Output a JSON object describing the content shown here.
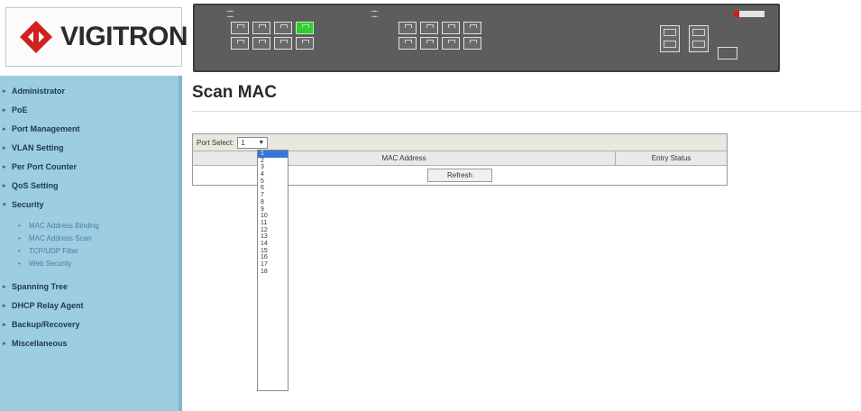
{
  "logo": {
    "text": "VIGITRON"
  },
  "sidebar": {
    "items": [
      {
        "label": "Administrator"
      },
      {
        "label": "PoE"
      },
      {
        "label": "Port Management"
      },
      {
        "label": "VLAN Setting"
      },
      {
        "label": "Per Port Counter"
      },
      {
        "label": "QoS Setting"
      },
      {
        "label": "Security"
      },
      {
        "label": "Spanning Tree"
      },
      {
        "label": "DHCP Relay Agent"
      },
      {
        "label": "Backup/Recovery"
      },
      {
        "label": "Miscellaneous"
      }
    ],
    "security_sub": [
      {
        "label": "MAC Address Binding"
      },
      {
        "label": "MAC Address Scan"
      },
      {
        "label": "TCP/UDP Filter"
      },
      {
        "label": "Web Security"
      }
    ]
  },
  "main": {
    "title": "Scan MAC",
    "port_select_label": "Port Select:",
    "port_select_value": "1",
    "col_mac": "MAC Address",
    "col_status": "Entry Status",
    "refresh_label": "Refresh"
  },
  "dropdown": {
    "options": [
      "1",
      "2",
      "3",
      "4",
      "5",
      "6",
      "7",
      "8",
      "9",
      "10",
      "11",
      "12",
      "13",
      "14",
      "15",
      "16",
      "17",
      "18"
    ],
    "selected": "1"
  },
  "colors": {
    "sidebar_bg": "#9ccde0",
    "selected_option": "#3875d7",
    "active_port": "#33cc33"
  }
}
